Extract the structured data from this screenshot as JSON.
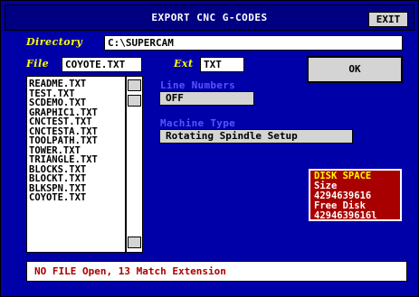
{
  "title": "EXPORT CNC G-CODES",
  "exit_label": "EXIT",
  "directory": {
    "label": "Directory",
    "value": "C:\\SUPERCAM"
  },
  "file": {
    "label": "File",
    "value": "COYOTE.TXT"
  },
  "ext": {
    "label": "Ext",
    "value": "TXT"
  },
  "ok_label": "OK",
  "files": [
    "README.TXT",
    "TEST.TXT",
    "SCDEMO.TXT",
    "GRAPHIC1.TXT",
    "CNCTEST.TXT",
    "CNCTESTA.TXT",
    "TOOLPATH.TXT",
    "TOWER.TXT",
    "TRIANGLE.TXT",
    "BLOCKS.TXT",
    "BLOCKT.TXT",
    "BLKSPN.TXT",
    "COYOTE.TXT"
  ],
  "line_numbers": {
    "label": "Line Numbers",
    "value": "OFF"
  },
  "machine_type": {
    "label": "Machine Type",
    "value": "Rotating Spindle Setup"
  },
  "disk": {
    "heading": "DISK SPACE",
    "size_label": "Size",
    "size_value": "4294639616",
    "free_label": "Free Disk",
    "free_value": "4294639616l"
  },
  "status": "NO FILE Open, 13 Match Extension"
}
